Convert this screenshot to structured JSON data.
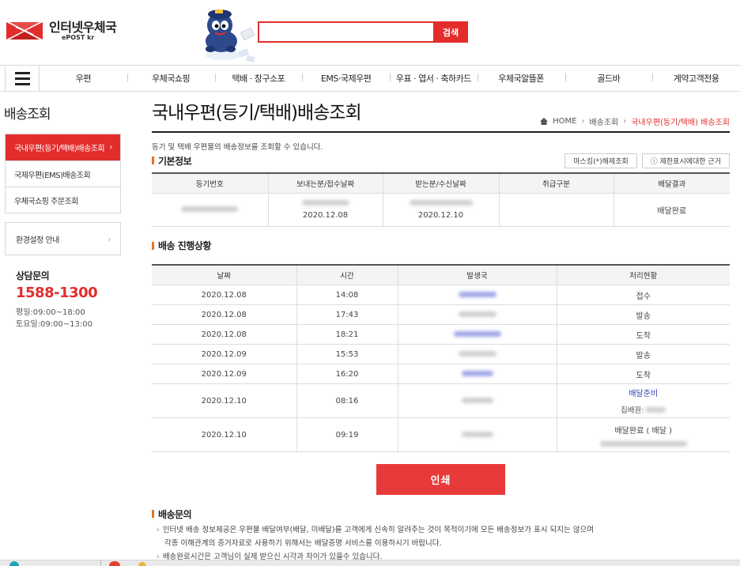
{
  "header": {
    "logo_ko": "인터넷우체국",
    "logo_en": "ePOST kr",
    "search_placeholder": "",
    "search_button": "검색",
    "colors": {
      "brand_red": "#e32d2d"
    }
  },
  "gnb": {
    "items": [
      "우편",
      "우체국쇼핑",
      "택배 · 창구소포",
      "EMS·국제우편",
      "우표 · 엽서 · 축하카드",
      "우체국알뜰폰",
      "골드바",
      "계약고객전용"
    ]
  },
  "lnb": {
    "title": "배송조회",
    "items": [
      {
        "label": "국내우편(등기/택배)배송조회",
        "active": true
      },
      {
        "label": "국제우편(EMS)배송조회",
        "active": false
      },
      {
        "label": "우체국쇼핑 주문조회",
        "active": false
      }
    ],
    "env_label": "환경설정 안내",
    "contact_title": "상담문의",
    "contact_phone": "1588-1300",
    "hours_weekday": "평일:09:00~18:00",
    "hours_saturday": "토요일:09:00~13:00"
  },
  "main": {
    "title": "국내우편(등기/택배)배송조회",
    "breadcrumb": {
      "home": "HOME",
      "parent": "배송조회",
      "current": "국내우편(등기/택배) 배송조회"
    },
    "description": "등기 및 택배 우편물의 배송정보를 조회할 수 있습니다.",
    "basic": {
      "title": "기본정보",
      "btn_masking": "마스킹(*)해제조회",
      "btn_restrict": "ⓘ 제한표시에대한 근거",
      "headers": [
        "등기번호",
        "보내는분/접수날짜",
        "받는분/수신날짜",
        "취급구분",
        "배달결과"
      ],
      "row": {
        "sent_date": "2020.12.08",
        "recv_date": "2020.12.10",
        "type": "",
        "result": "배달완료"
      }
    },
    "progress": {
      "title": "배송 진행상황",
      "headers": [
        "날짜",
        "시간",
        "발생국",
        "처리현황"
      ],
      "rows": [
        {
          "date": "2020.12.08",
          "time": "14:08",
          "status": "접수"
        },
        {
          "date": "2020.12.08",
          "time": "17:43",
          "status": "발송"
        },
        {
          "date": "2020.12.08",
          "time": "18:21",
          "status": "도착"
        },
        {
          "date": "2020.12.09",
          "time": "15:53",
          "status": "발송"
        },
        {
          "date": "2020.12.09",
          "time": "16:20",
          "status": "도착"
        },
        {
          "date": "2020.12.10",
          "time": "08:16",
          "status": "배달준비",
          "sub": "집배원:"
        },
        {
          "date": "2020.12.10",
          "time": "09:19",
          "status": "배달완료 ( 배달 )"
        }
      ]
    },
    "print_label": "인쇄",
    "inquiry": {
      "title": "배송문의",
      "lines": [
        "인터넷 배송 정보제공은 우편물 배달여부(배달, 미배달)를 고객에게 신속히 알려주는 것이 목적이기에 모든 배송정보가 표시 되지는 않으며",
        "각종 이해관계의 증거자료로 사용하기 위해서는 배달증명 서비스를 이용하시기 바랍니다.",
        "배송완료시간은 고객님이 실제 받으신 시각과 차이가 있을수 있습니다."
      ]
    }
  }
}
